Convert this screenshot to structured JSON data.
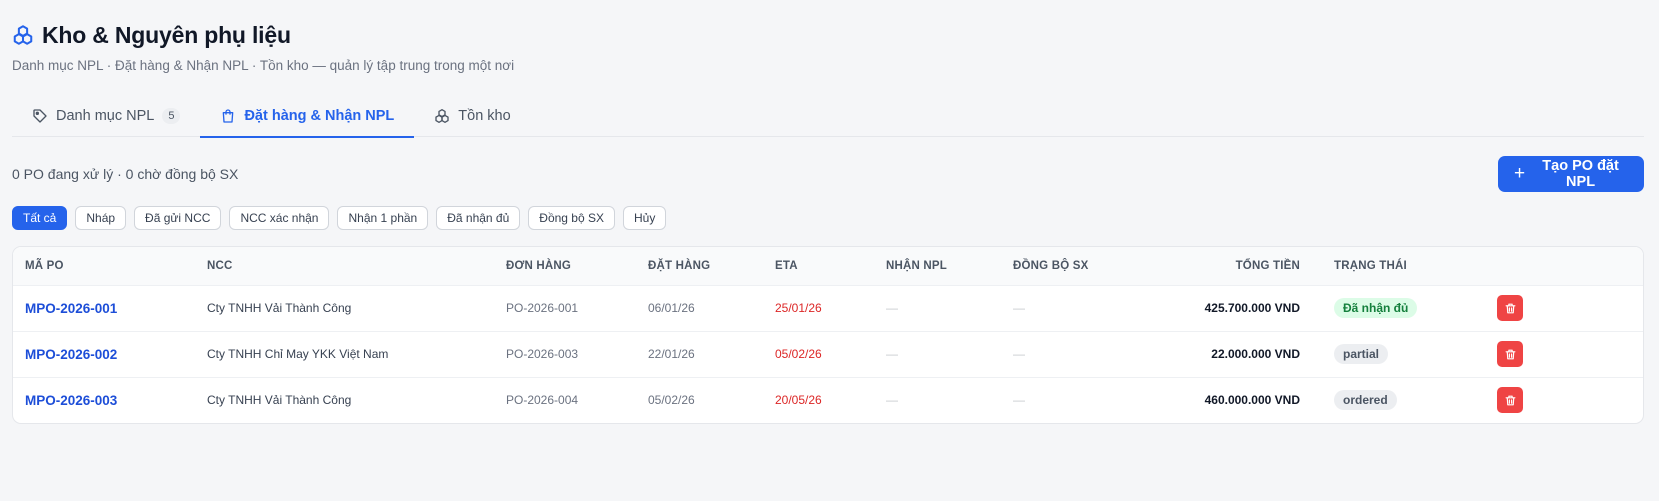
{
  "header": {
    "title": "Kho & Nguyên phụ liệu",
    "subtitle": "Danh mục NPL · Đặt hàng & Nhận NPL · Tồn kho — quản lý tập trung trong một nơi",
    "icon": "boxes-icon"
  },
  "tabs": [
    {
      "label": "Danh mục NPL",
      "count": "5",
      "icon": "tag-icon",
      "active": false
    },
    {
      "label": "Đặt hàng & Nhận NPL",
      "icon": "shopping-bag-icon",
      "active": true
    },
    {
      "label": "Tồn kho",
      "icon": "boxes-icon",
      "active": false
    }
  ],
  "toolbar": {
    "summary": "0 PO đang xử lý · 0 chờ đồng bộ SX",
    "create_label": "Tạo PO đặt NPL"
  },
  "filters": [
    {
      "label": "Tất cả",
      "active": true
    },
    {
      "label": "Nháp"
    },
    {
      "label": "Đã gửi NCC"
    },
    {
      "label": "NCC xác nhận"
    },
    {
      "label": "Nhận 1 phần"
    },
    {
      "label": "Đã nhận đủ"
    },
    {
      "label": "Đồng bộ SX"
    },
    {
      "label": "Hủy"
    }
  ],
  "table": {
    "columns": [
      "MÃ PO",
      "NCC",
      "ĐƠN HÀNG",
      "ĐẶT HÀNG",
      "ETA",
      "NHẬN NPL",
      "ĐỒNG BỘ SX",
      "TỔNG TIỀN",
      "TRẠNG THÁI"
    ],
    "rows": [
      {
        "po": "MPO-2026-001",
        "ncc": "Cty TNHH Vải Thành Công",
        "order": "PO-2026-001",
        "ordered": "06/01/26",
        "eta": "25/01/26",
        "received": "—",
        "sync": "—",
        "total": "425.700.000 VND",
        "status": "Đã nhận đủ"
      },
      {
        "po": "MPO-2026-002",
        "ncc": "Cty TNHH Chỉ May YKK Việt Nam",
        "order": "PO-2026-003",
        "ordered": "22/01/26",
        "eta": "05/02/26",
        "received": "—",
        "sync": "—",
        "total": "22.000.000 VND",
        "status": "partial"
      },
      {
        "po": "MPO-2026-003",
        "ncc": "Cty TNHH Vải Thành Công",
        "order": "PO-2026-004",
        "ordered": "05/02/26",
        "eta": "20/05/26",
        "received": "—",
        "sync": "—",
        "total": "460.000.000 VND",
        "status": "ordered"
      }
    ]
  },
  "colors": {
    "accent": "#2563eb",
    "danger": "#ef4444",
    "eta": "#dc2626",
    "success_bg": "#dcfce7",
    "success_text": "#15803d"
  }
}
